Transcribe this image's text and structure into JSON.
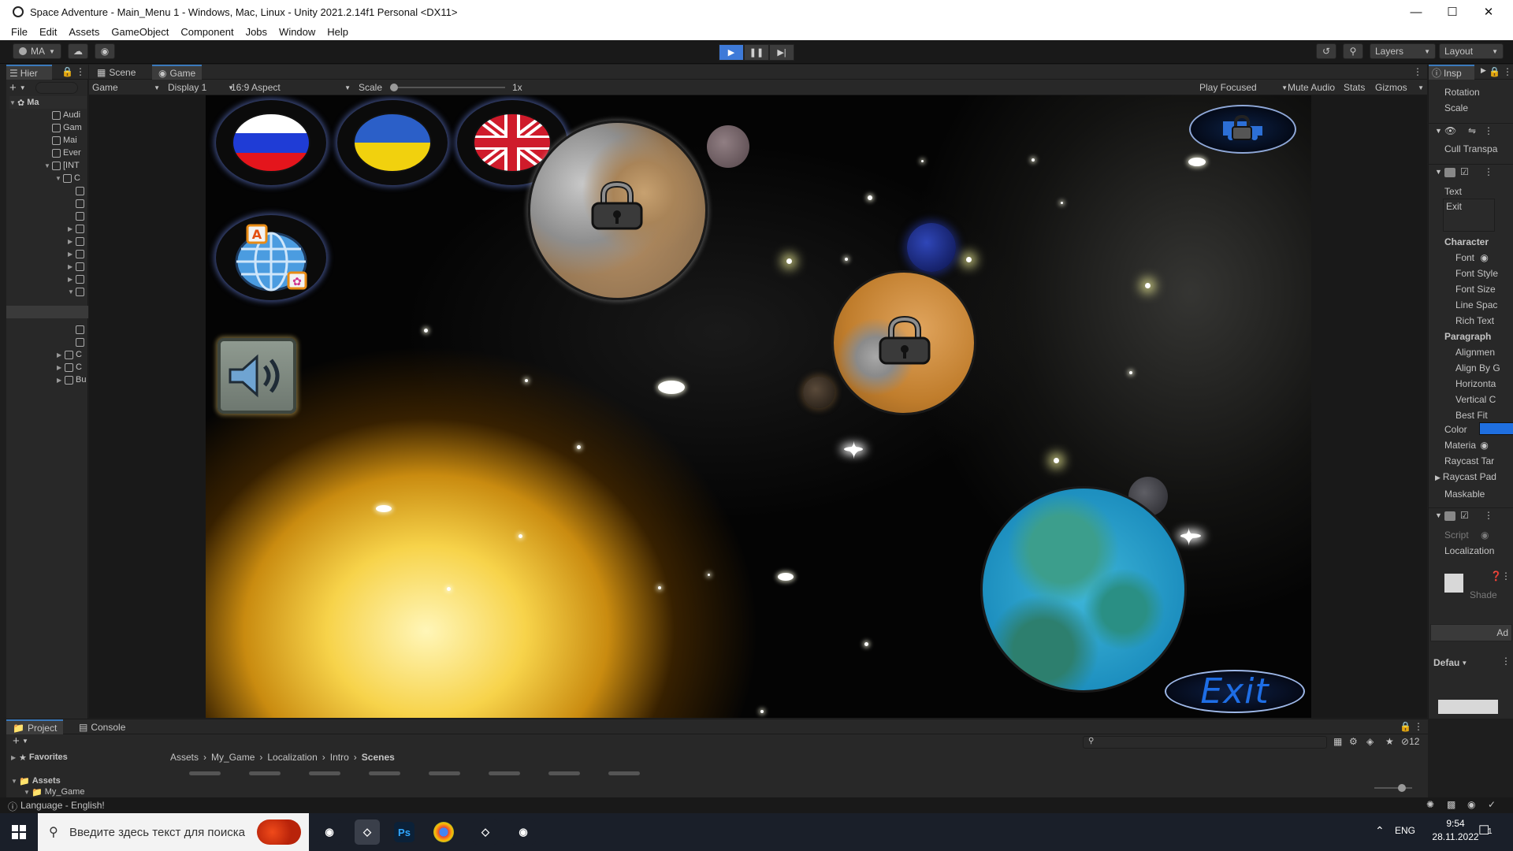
{
  "window": {
    "title": "Space Adventure - Main_Menu 1 - Windows, Mac, Linux - Unity 2021.2.14f1 Personal <DX11>"
  },
  "menu": [
    "File",
    "Edit",
    "Assets",
    "GameObject",
    "Component",
    "Jobs",
    "Window",
    "Help"
  ],
  "toolbar": {
    "account": "MA",
    "layers": "Layers",
    "layout": "Layout"
  },
  "hierarchy": {
    "tab": "Hier",
    "root": "Ma",
    "items": [
      "Audi",
      "Gam",
      "Mai",
      "Ever",
      "[INT",
      "C",
      "C",
      "C",
      "Bu"
    ]
  },
  "views": {
    "scene_tab": "Scene",
    "game_tab": "Game"
  },
  "gamebar": {
    "mode": "Game",
    "display": "Display 1",
    "aspect": "16:9 Aspect",
    "scale_label": "Scale",
    "scale_value": "1x",
    "play_focused": "Play Focused",
    "mute_audio": "Mute Audio",
    "stats": "Stats",
    "gizmos": "Gizmos"
  },
  "game": {
    "exit_label": "Exit"
  },
  "inspector": {
    "tab": "Insp",
    "rows": {
      "rotation": "Rotation",
      "scale": "Scale",
      "cull": "Cull Transpa",
      "text": "Text",
      "text_value": "Exit",
      "character": "Character",
      "font": "Font",
      "font_style": "Font Style",
      "font_size": "Font Size",
      "line_spacing": "Line Spac",
      "rich_text": "Rich Text",
      "paragraph": "Paragraph",
      "alignment": "Alignmen",
      "align_by": "Align By G",
      "horizontal": "Horizonta",
      "vertical": "Vertical C",
      "best_fit": "Best Fit",
      "color": "Color",
      "material": "Materia",
      "raycast_target": "Raycast Tar",
      "raycast_padding": "Raycast Pad",
      "maskable": "Maskable",
      "script": "Script",
      "localization": "Localization",
      "shader": "Shade",
      "add": "Ad",
      "default": "Defau"
    },
    "color_swatch": "#1f6fe0"
  },
  "project": {
    "tab": "Project",
    "console_tab": "Console",
    "favorites": "Favorites",
    "assets": "Assets",
    "my_game": "My_Game",
    "breadcrumb": [
      "Assets",
      "My_Game",
      "Localization",
      "Intro",
      "Scenes"
    ],
    "hidden_count": "12"
  },
  "status": {
    "message": "Language - English!"
  },
  "taskbar": {
    "search_placeholder": "Введите здесь текст для поиска",
    "lang": "ENG",
    "time": "9:54",
    "date": "28.11.2022",
    "notifications": "1"
  }
}
